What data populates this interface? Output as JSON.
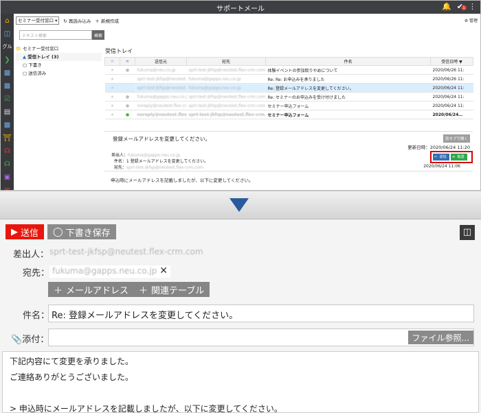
{
  "app": {
    "title": "サポートメール",
    "top_icons": [
      "bell-icon",
      "check-icon",
      "more-icon"
    ],
    "check_badge": "1",
    "left_icons": [
      "home-icon",
      "database-icon",
      "group-icon",
      "arrow-icon",
      "chat-icon",
      "chat2-icon",
      "check-icon",
      "doc-icon",
      "memo-icon",
      "building-icon",
      "headset-icon",
      "headset2-icon",
      "box-icon",
      "mail-icon"
    ],
    "left_group_label": "グル"
  },
  "toolbar": {
    "mailbox_select": "セミナー受付窓口",
    "refresh": "再読み込み",
    "new": "新規作成",
    "manage": "管理"
  },
  "search": {
    "placeholder": "テキスト検索",
    "button": "検索"
  },
  "tree": {
    "root": "セミナー受付窓口",
    "inbox": "受信トレイ (3)",
    "drafts": "下書き",
    "sent": "送信済み"
  },
  "inbox": {
    "title": "受信トレイ",
    "columns": [
      "送信元",
      "宛先",
      "件名",
      "受信日時"
    ],
    "rows": [
      {
        "from": "fukuma@neu.co.jp",
        "to": "sprt-test-jkfsp@neutest.flex-crm.com",
        "subject": "体験イベントの参加取りやめについて",
        "date": "2020/06/26 11:"
      },
      {
        "from": "sprt-test-jkfsp@neutest.flex-crm.com",
        "to": "fukuma@gapps.neu.co.jp",
        "subject": "Re: Re: お申込みを承りました",
        "date": "2020/06/26 11:"
      },
      {
        "from": "sprt-test-jkfsp@neutest.flex-crm.com",
        "to": "fukuma@gapps.neu.co.jp",
        "subject": "Re: 登録メールアドレスを変更してください。",
        "date": "2020/06/24 11:"
      },
      {
        "from": "fukuma@gapps.neu.co.jp",
        "to": "sprt-test-jkfsp@neutest.flex-crm.com",
        "subject": "Re: セミナーのお申込みを受け付けました",
        "date": "2020/06/24 11:"
      },
      {
        "from": "noreply@neutest.flex-crm.com",
        "to": "sprt-test-jkfsp@neutest.flex-crm.com",
        "subject": "セミナー申込フォーム",
        "date": "2020/06/24 11:"
      },
      {
        "from": "noreply@neutest.flex-crm.com",
        "to": "sprt-test-jkfsp@neutest.flex-crm.com",
        "subject": "セミナー申込フォーム",
        "date": "2020/06/24…"
      }
    ]
  },
  "preview": {
    "subject": "登録メールアドレスを変更してください。",
    "open_new_tab": "別タブで開く",
    "updated": "更新日時：2020/06/24 11:20",
    "from_label": "差出人：",
    "from_value": "fukuma@gapps.neu.co.jp",
    "subject_label": "件名：",
    "subject_value": "1 登録メールアドレスを変更してください。",
    "to_label": "宛先：",
    "to_value": "sprt-test-jkfsp@neutest.flex-crm.com",
    "reply": "返信",
    "forward": "転送",
    "date": "2020/06/24 11:06",
    "body": "申込時にメールアドレスを記載しましたが、以下に変更してください。"
  },
  "compose": {
    "send": "送信",
    "draft": "下書き保存",
    "from_label": "差出人：",
    "from_value": "sprt-test-jkfsp@neutest.flex-crm.com",
    "to_label": "宛先：",
    "to_value": "fukuma@gapps.neu.co.jp",
    "add_address": "メールアドレス",
    "related_table": "関連テーブル",
    "subject_label": "件名：",
    "subject_value": "Re: 登録メールアドレスを変更してください。",
    "attach_label": "添付：",
    "file_browse": "ファイル参照...",
    "body_lines": [
      "下記内容にて変更を承りました。",
      "ご連絡ありがとうございました。",
      "",
      "> 申込時にメールアドレスを記載しましたが、以下に変更してください。"
    ]
  },
  "colors": {
    "send_red": "#e8160c",
    "highlight_red": "#d40000",
    "arrow_blue": "#2a5a9c",
    "titlebar": "#3e3f42"
  }
}
